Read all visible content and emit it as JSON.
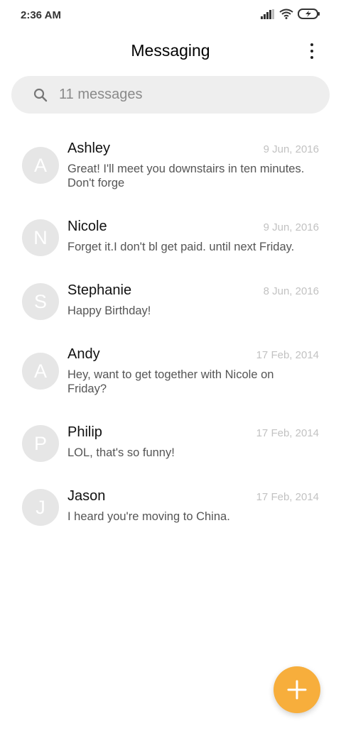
{
  "status_bar": {
    "time": "2:36 AM",
    "icons": [
      "signal-icon",
      "wifi-icon",
      "battery-charging-icon"
    ]
  },
  "app_bar": {
    "title": "Messaging",
    "menu_icon": "more-vert-icon"
  },
  "search": {
    "icon": "search-icon",
    "placeholder": "11 messages"
  },
  "conversations": [
    {
      "initial": "A",
      "name": "Ashley",
      "date": "9 Jun, 2016",
      "snippet": "Great! I'll meet you downstairs in ten minutes. Don't forge"
    },
    {
      "initial": "N",
      "name": "Nicole",
      "date": "9 Jun, 2016",
      "snippet": "Forget it.I don't bl get paid. until next Friday."
    },
    {
      "initial": "S",
      "name": "Stephanie",
      "date": "8 Jun, 2016",
      "snippet": "Happy Birthday!"
    },
    {
      "initial": "A",
      "name": "Andy",
      "date": "17 Feb, 2014",
      "snippet": "Hey, want to get together with Nicole on Friday?"
    },
    {
      "initial": "P",
      "name": "Philip",
      "date": "17 Feb, 2014",
      "snippet": "LOL, that's so funny!"
    },
    {
      "initial": "J",
      "name": "Jason",
      "date": "17 Feb, 2014",
      "snippet": "I heard you're moving to China."
    }
  ],
  "fab": {
    "icon": "plus-icon"
  },
  "colors": {
    "accent": "#f7ae3c",
    "avatar_bg": "#e6e6e6",
    "search_bg": "#eeeeee",
    "date_text": "#c2c2c2"
  }
}
